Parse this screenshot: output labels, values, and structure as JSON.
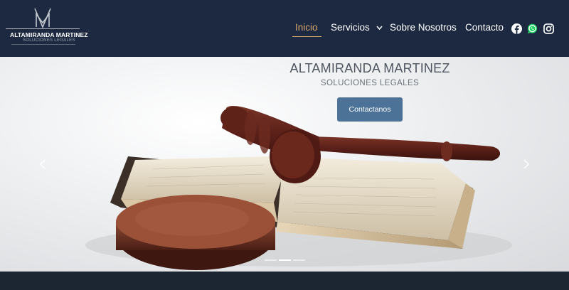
{
  "brand": {
    "name": "ALTAMIRANDA MARTINEZ",
    "tagline": "SOLUCIONES LEGALES"
  },
  "nav": {
    "items": [
      {
        "label": "Inicio",
        "active": true
      },
      {
        "label": "Servicios",
        "has_dropdown": true
      },
      {
        "label": "Sobre Nosotros"
      },
      {
        "label": "Contacto"
      }
    ]
  },
  "social": [
    "facebook-icon",
    "whatsapp-icon",
    "instagram-icon"
  ],
  "hero": {
    "title": "ALTAMIRANDA MARTINEZ",
    "subtitle": "SOLUCIONES LEGALES",
    "cta_label": "Contactanos",
    "slides_total": 3,
    "active_slide": 2
  },
  "colors": {
    "header_bg": "#1c2940",
    "accent": "#d7a86e",
    "button": "#4c7397"
  }
}
